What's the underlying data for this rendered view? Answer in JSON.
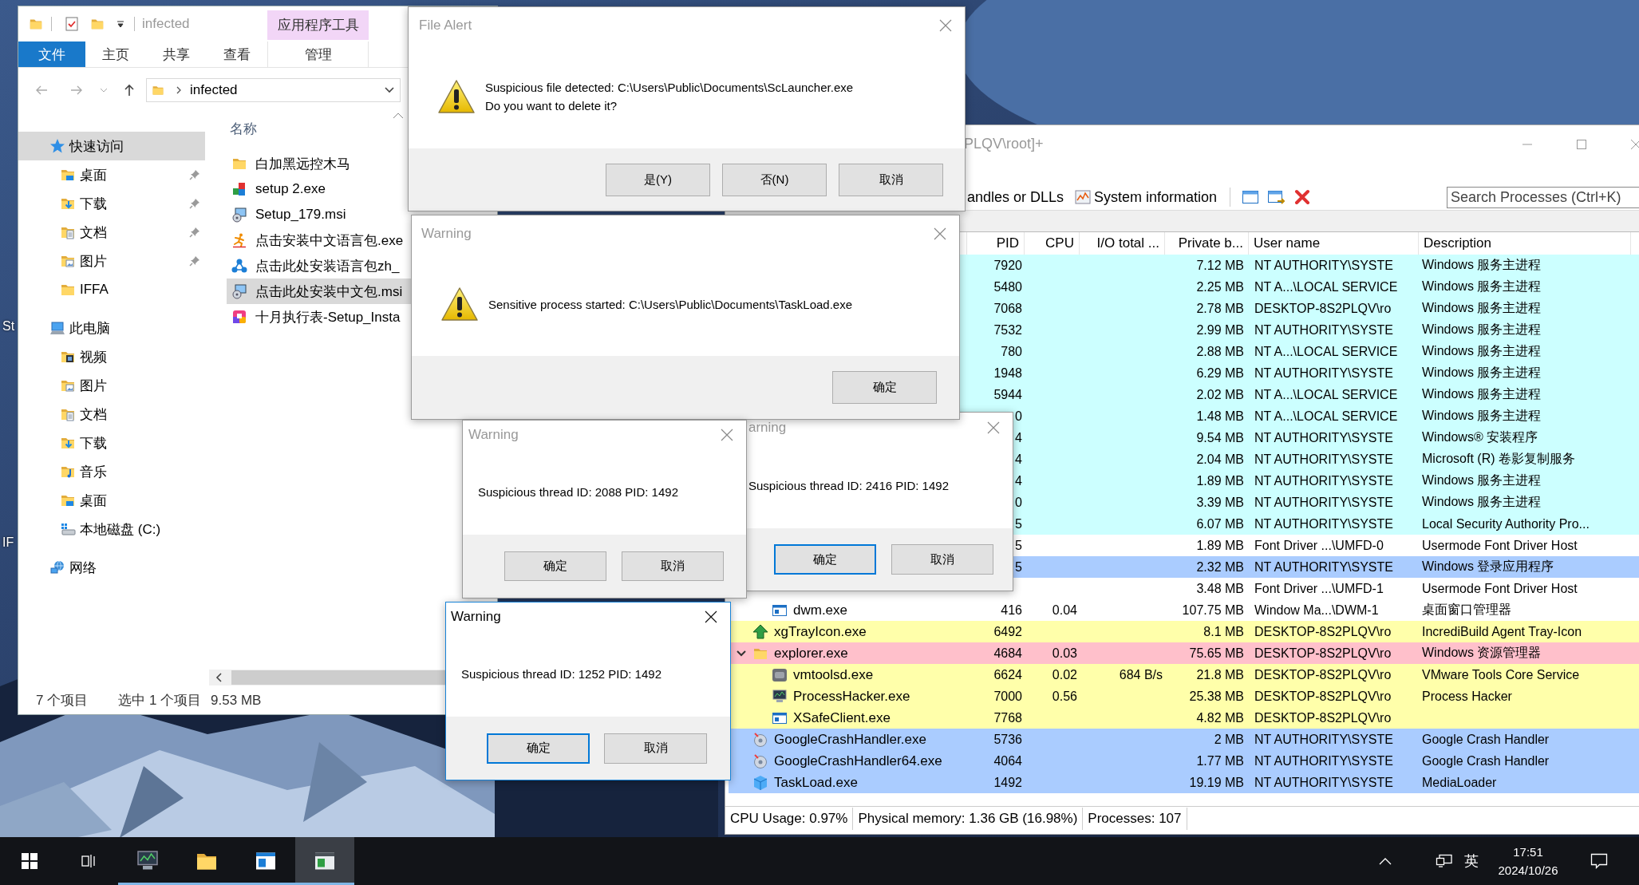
{
  "desktop": {
    "labels": [
      "St",
      "IF"
    ]
  },
  "explorer": {
    "title": "infected",
    "context_header": "应用程序工具",
    "ribbon_tabs": [
      {
        "label": "文件",
        "selected": true,
        "contextual": false
      },
      {
        "label": "主页",
        "selected": false,
        "contextual": false
      },
      {
        "label": "共享",
        "selected": false,
        "contextual": false
      },
      {
        "label": "查看",
        "selected": false,
        "contextual": false
      },
      {
        "label": "管理",
        "selected": false,
        "contextual": true
      }
    ],
    "address": "infected",
    "nav": [
      {
        "label": "快速访问",
        "kind": "star",
        "selected": true,
        "children": [
          {
            "label": "桌面",
            "kind": "desktop",
            "pinned": true,
            "selected": false
          },
          {
            "label": "下载",
            "kind": "download",
            "pinned": true,
            "selected": false
          },
          {
            "label": "文档",
            "kind": "document",
            "pinned": true,
            "selected": false
          },
          {
            "label": "图片",
            "kind": "picture",
            "pinned": true,
            "selected": false
          },
          {
            "label": "IFFA",
            "kind": "folder",
            "pinned": false,
            "selected": false
          }
        ]
      },
      {
        "label": "此电脑",
        "kind": "computer",
        "selected": false,
        "children": [
          {
            "label": "视频",
            "kind": "video",
            "selected": false
          },
          {
            "label": "图片",
            "kind": "picture",
            "selected": false
          },
          {
            "label": "文档",
            "kind": "document",
            "selected": false
          },
          {
            "label": "下载",
            "kind": "download",
            "selected": false
          },
          {
            "label": "音乐",
            "kind": "music",
            "selected": false
          },
          {
            "label": "桌面",
            "kind": "desktop",
            "selected": false
          },
          {
            "label": "本地磁盘 (C:)",
            "kind": "drive",
            "selected": false
          }
        ]
      },
      {
        "label": "网络",
        "kind": "network",
        "selected": false
      }
    ],
    "column": "名称",
    "files": [
      {
        "name": "白加黑远控木马",
        "kind": "folder",
        "selected": false
      },
      {
        "name": "setup 2.exe",
        "kind": "setup",
        "selected": false
      },
      {
        "name": "Setup_179.msi",
        "kind": "installer",
        "selected": false
      },
      {
        "name": "点击安装中文语言包.exe",
        "kind": "runner",
        "selected": false
      },
      {
        "name": "点击此处安装语言包zh_",
        "kind": "nodes",
        "selected": false
      },
      {
        "name": "点击此处安装中文包.msi",
        "kind": "installer",
        "selected": true
      },
      {
        "name": "十月执行表-Setup_Insta",
        "kind": "tiles",
        "selected": false
      }
    ],
    "status": [
      "7 个项目",
      "选中 1 个项目",
      "9.53 MB"
    ]
  },
  "process_hacker": {
    "title": "PLQV\\root]+",
    "toolbar": [
      {
        "label": "andles or DLLs"
      },
      {
        "label": "System information",
        "kind": "chart"
      }
    ],
    "search": {
      "placeholder": "Search Processes (Ctrl+K)"
    },
    "columns": [
      "PID",
      "CPU",
      "I/O total ...",
      "Private b...",
      "User name",
      "Description"
    ],
    "rows": [
      {
        "pid": "7920",
        "private": "7.12 MB",
        "user": "NT AUTHORITY\\SYSTE",
        "description": "Windows 服务主进程",
        "color": "#ccffff"
      },
      {
        "pid": "5480",
        "private": "2.25 MB",
        "user": "NT A...\\LOCAL SERVICE",
        "description": "Windows 服务主进程",
        "color": "#ccffff"
      },
      {
        "pid": "7068",
        "private": "2.78 MB",
        "user": "DESKTOP-8S2PLQV\\ro",
        "description": "Windows 服务主进程",
        "color": "#ccffff"
      },
      {
        "pid": "7532",
        "private": "2.99 MB",
        "user": "NT AUTHORITY\\SYSTE",
        "description": "Windows 服务主进程",
        "color": "#ccffff"
      },
      {
        "pid": "780",
        "private": "2.88 MB",
        "user": "NT A...\\LOCAL SERVICE",
        "description": "Windows 服务主进程",
        "color": "#ccffff"
      },
      {
        "pid": "1948",
        "private": "6.29 MB",
        "user": "NT AUTHORITY\\SYSTE",
        "description": "Windows 服务主进程",
        "color": "#ccffff"
      },
      {
        "pid": "5944",
        "private": "2.02 MB",
        "user": "NT A...\\LOCAL SERVICE",
        "description": "Windows 服务主进程",
        "color": "#ccffff"
      },
      {
        "pid": "0",
        "private": "1.48 MB",
        "user": "NT A...\\LOCAL SERVICE",
        "description": "Windows 服务主进程",
        "color": "#ccffff"
      },
      {
        "pid": "4",
        "private": "9.54 MB",
        "user": "NT AUTHORITY\\SYSTE",
        "description": "Windows® 安装程序",
        "color": "#ccffff"
      },
      {
        "pid": "4",
        "private": "2.04 MB",
        "user": "NT AUTHORITY\\SYSTE",
        "description": "Microsoft (R) 卷影复制服务",
        "color": "#ccffff"
      },
      {
        "pid": "4",
        "private": "1.89 MB",
        "user": "NT AUTHORITY\\SYSTE",
        "description": "Windows 服务主进程",
        "color": "#ccffff"
      },
      {
        "pid": "0",
        "private": "3.39 MB",
        "user": "NT AUTHORITY\\SYSTE",
        "description": "Windows 服务主进程",
        "color": "#ccffff"
      },
      {
        "pid": "5",
        "private": "6.07 MB",
        "user": "NT AUTHORITY\\SYSTE",
        "description": "Local Security Authority Pro...",
        "color": "#ccffff"
      },
      {
        "pid": "5",
        "private": "1.89 MB",
        "user": "Font Driver ...\\UMFD-0",
        "description": "Usermode Font Driver Host",
        "color": "#ffffff"
      },
      {
        "pid": "5",
        "private": "2.32 MB",
        "user": "NT AUTHORITY\\SYSTE",
        "description": "Windows 登录应用程序",
        "color": "#aaccff",
        "children": [
          {
            "private": "3.48 MB",
            "user": "Font Driver ...\\UMFD-1",
            "description": "Usermode Font Driver Host",
            "color": "#ffffff"
          },
          {
            "name": "dwm.exe",
            "kind": "window",
            "pid": "416",
            "cpu": "0.04",
            "private": "107.75 MB",
            "user": "Window Ma...\\DWM-1",
            "description": "桌面窗口管理器",
            "color": "#ffffff"
          }
        ]
      },
      {
        "name": "xgTrayIcon.exe",
        "kind": "arrow",
        "pid": "6492",
        "private": "8.1 MB",
        "user": "DESKTOP-8S2PLQV\\ro",
        "description": "IncrediBuild Agent Tray-Icon",
        "color": "#ffffaa"
      },
      {
        "name": "explorer.exe",
        "kind": "folder",
        "pid": "4684",
        "cpu": "0.03",
        "private": "75.65 MB",
        "user": "DESKTOP-8S2PLQV\\ro",
        "description": "Windows 资源管理器",
        "color": "#ffc0cb",
        "expanded": true,
        "children": [
          {
            "name": "vmtoolsd.exe",
            "kind": "vm",
            "pid": "6624",
            "cpu": "0.02",
            "io": "684 B/s",
            "private": "21.8 MB",
            "user": "DESKTOP-8S2PLQV\\ro",
            "description": "VMware Tools Core Service",
            "color": "#ffffaa"
          },
          {
            "name": "ProcessHacker.exe",
            "kind": "monitor",
            "pid": "7000",
            "cpu": "0.56",
            "private": "25.38 MB",
            "user": "DESKTOP-8S2PLQV\\ro",
            "description": "Process Hacker",
            "color": "#ffffaa"
          },
          {
            "name": "XSafeClient.exe",
            "kind": "window",
            "pid": "7768",
            "private": "4.82 MB",
            "user": "DESKTOP-8S2PLQV\\ro",
            "color": "#ffffaa"
          }
        ]
      },
      {
        "name": "GoogleCrashHandler.exe",
        "kind": "disc",
        "pid": "5736",
        "private": "2 MB",
        "user": "NT AUTHORITY\\SYSTE",
        "description": "Google Crash Handler",
        "color": "#aaccff"
      },
      {
        "name": "GoogleCrashHandler64.exe",
        "kind": "disc",
        "pid": "4064",
        "private": "1.77 MB",
        "user": "NT AUTHORITY\\SYSTE",
        "description": "Google Crash Handler",
        "color": "#aaccff"
      },
      {
        "name": "TaskLoad.exe",
        "kind": "cube",
        "pid": "1492",
        "private": "19.19 MB",
        "user": "NT AUTHORITY\\SYSTE",
        "description": "MediaLoader",
        "color": "#aaccff"
      }
    ],
    "status": [
      "CPU Usage: 0.97%",
      "Physical memory: 1.36 GB (16.98%)",
      "Processes: 107"
    ]
  },
  "dialogs": [
    {
      "title": "File Alert",
      "active": false,
      "kind": "warning",
      "message": [
        "Suspicious file detected: C:\\Users\\Public\\Documents\\ScLauncher.exe",
        "Do you want to delete it?"
      ],
      "buttons": [
        {
          "label": "是(Y)",
          "focused": false
        },
        {
          "label": "否(N)",
          "focused": false
        },
        {
          "label": "取消",
          "focused": false
        }
      ]
    },
    {
      "title": "Warning",
      "active": false,
      "kind": "warning",
      "message": [
        "Sensitive process started: C:\\Users\\Public\\Documents\\TaskLoad.exe"
      ],
      "buttons": [
        {
          "label": "确定",
          "focused": false
        }
      ]
    },
    {
      "title": "Warning",
      "active": false,
      "message": [
        "Suspicious thread ID: 2088 PID: 1492"
      ],
      "buttons": [
        {
          "label": "确定",
          "focused": false
        },
        {
          "label": "取消",
          "focused": false
        }
      ]
    },
    {
      "title": "arning",
      "active": false,
      "message": [
        "Suspicious thread ID: 2416 PID: 1492"
      ],
      "buttons": [
        {
          "label": "确定",
          "focused": true
        },
        {
          "label": "取消",
          "focused": false
        }
      ]
    },
    {
      "title": "Warning",
      "active": true,
      "message": [
        "Suspicious thread ID: 1252 PID: 1492"
      ],
      "buttons": [
        {
          "label": "确定",
          "focused": true
        },
        {
          "label": "取消",
          "focused": false
        }
      ]
    }
  ],
  "taskbar": {
    "apps": [
      {
        "kind": "monitor",
        "running": true,
        "selected": false
      },
      {
        "kind": "folder",
        "running": true,
        "selected": false
      },
      {
        "kind": "bluewindow",
        "running": true,
        "selected": false
      },
      {
        "kind": "greenwindow",
        "running": true,
        "selected": true
      }
    ],
    "input_method": "英",
    "time": "17:51",
    "date": "2024/10/26"
  }
}
